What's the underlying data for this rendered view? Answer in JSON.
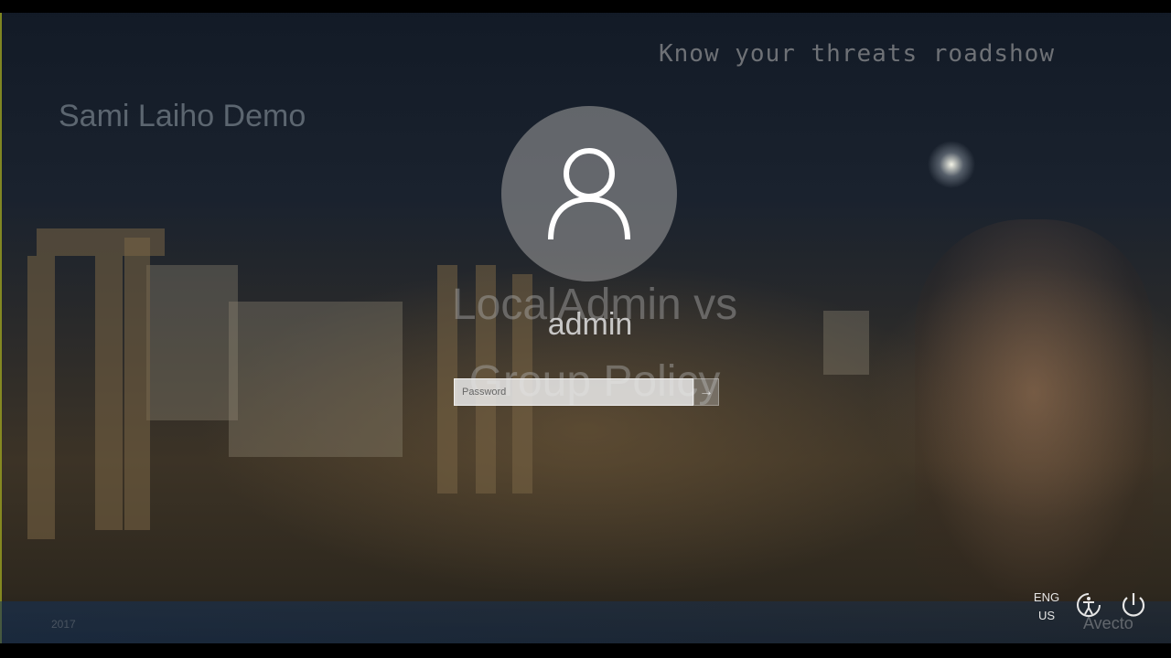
{
  "overlay": {
    "demo_title": "Sami Laiho Demo",
    "roadshow_label": "Know your threats roadshow",
    "slide_title_line1": "LocalAdmin vs",
    "slide_title_line2": "Group Policy",
    "year": "2017",
    "brand": "Avecto"
  },
  "login": {
    "avatar_icon": "user-icon",
    "username": "admin",
    "password_placeholder": "Password",
    "submit_icon": "arrow-right-icon"
  },
  "system": {
    "language_line1": "ENG",
    "language_line2": "US",
    "ease_of_access_icon": "ease-of-access-icon",
    "power_icon": "power-icon"
  },
  "colors": {
    "footer_strip": "#14325a",
    "text_light": "#e6e6e6"
  }
}
